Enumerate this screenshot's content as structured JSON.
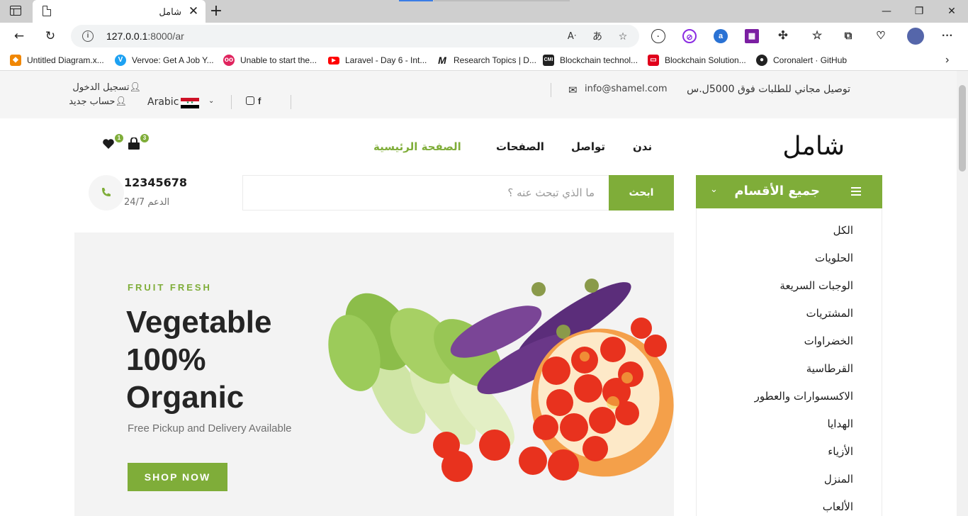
{
  "browser": {
    "tab_title": "شامل",
    "url_host": "127.0.0.1",
    "url_path": ":8000/ar",
    "bookmarks": [
      {
        "label": "Untitled Diagram.x...",
        "icon": "drawio-icon",
        "color": "#f08705"
      },
      {
        "label": "Vervoe: Get A Job Y...",
        "icon": "vervoe-icon",
        "color": "#1da1f2"
      },
      {
        "label": "Unable to start the...",
        "icon": "flickr-like-icon",
        "color": "#e0245e"
      },
      {
        "label": "Laravel - Day 6 - Int...",
        "icon": "youtube-icon",
        "color": "#ff0000"
      },
      {
        "label": "Research Topics | D...",
        "icon": "m-logo-icon",
        "color": "#111111"
      },
      {
        "label": "Blockchain technol...",
        "icon": "cmi-icon",
        "color": "#222222"
      },
      {
        "label": "Blockchain Solution...",
        "icon": "oracle-icon",
        "color": "#e0001b"
      },
      {
        "label": "Coronalert · GitHub",
        "icon": "github-icon",
        "color": "#222222"
      }
    ]
  },
  "topbar": {
    "shipping": "توصيل مجاني للطلبات فوق 5000ل.س",
    "email": "info@shamel.com",
    "language": "Arabic",
    "login": "تسجيل الدخول",
    "register": "حساب جديد"
  },
  "header": {
    "logo": "شامل",
    "nav": [
      "الصفحة الرئيسية",
      "الصفحات",
      "تواصل",
      "ندن"
    ],
    "cart_count": "3",
    "wishlist_count": "1"
  },
  "categories": {
    "title": "جميع الأقسام",
    "items": [
      "الكل",
      "الحلويات",
      "الوجبات السريعة",
      "المشتريات",
      "الخضراوات",
      "القرطاسية",
      "الاكسسوارات والعطور",
      "الهدايا",
      "الأزياء",
      "المنزل",
      "الألعاب"
    ]
  },
  "search": {
    "placeholder": "ما الذي تبحث عنه ؟",
    "button": "ابحث"
  },
  "support": {
    "phone": "12345678",
    "label": "الدعم 24/7"
  },
  "hero": {
    "kicker": "FRUIT FRESH",
    "title_line1": "Vegetable",
    "title_line2": "100%",
    "title_line3": "Organic",
    "subtitle": "Free Pickup and Delivery Available",
    "button": "SHOP NOW"
  },
  "colors": {
    "accent": "#7fad39",
    "topbar_bg": "#f5f5f5"
  }
}
